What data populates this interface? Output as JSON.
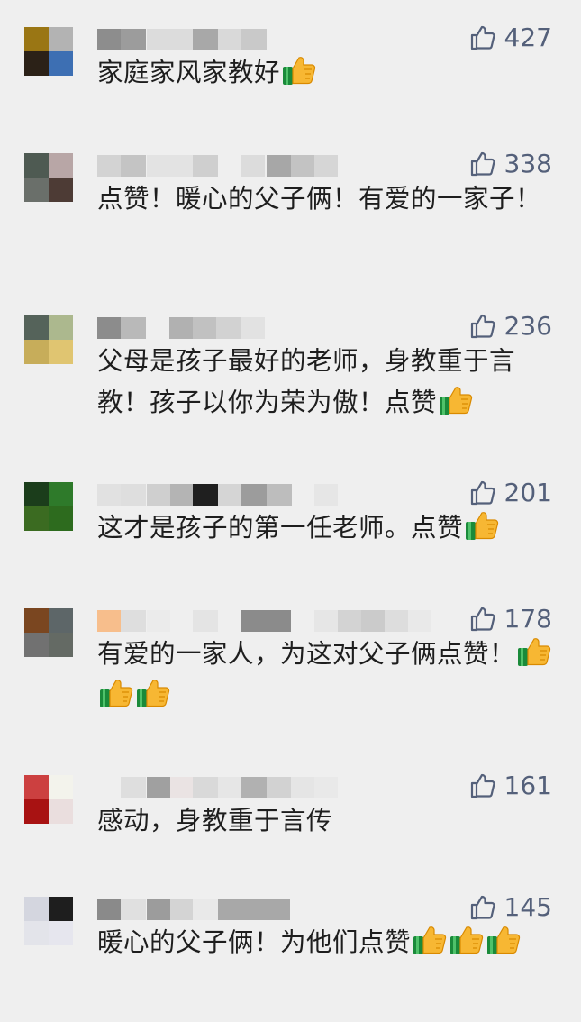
{
  "comments": [
    {
      "text": "家庭家风家教好",
      "likes": "427",
      "thumbs": 1,
      "avatar": [
        "#9a7614",
        "#b3b3b3",
        "#2b2117",
        "#3d6fb3"
      ],
      "name": [
        [
          "#8d8d8d",
          108,
          26
        ],
        [
          "#9c9c9c",
          134,
          28
        ],
        [
          "#dcdcdc",
          163,
          52
        ],
        [
          "#a8a8a8",
          214,
          28
        ],
        [
          "#d9d9d9",
          242,
          26
        ],
        [
          "#c9c9c9",
          268,
          28
        ]
      ]
    },
    {
      "text": "点赞！暖心的父子俩！有爱的一家子！",
      "likes": "338",
      "thumbs": 0,
      "avatar": [
        "#4e5a52",
        "#b8a6a6",
        "#6a6f6a",
        "#4d3b35"
      ],
      "name": [
        [
          "#d3d3d3",
          108,
          26
        ],
        [
          "#c4c4c4",
          134,
          28
        ],
        [
          "#e3e3e3",
          163,
          52
        ],
        [
          "#cfcfcf",
          214,
          28
        ],
        [
          "#dcdcdc",
          268,
          26
        ],
        [
          "#a7a7a7",
          296,
          28
        ],
        [
          "#c3c3c3",
          323,
          26
        ],
        [
          "#d6d6d6",
          349,
          26
        ]
      ]
    },
    {
      "text": "父母是孩子最好的老师，身教重于言教！孩子以你为荣为傲！点赞",
      "likes": "236",
      "thumbs": 1,
      "avatar": [
        "#55635a",
        "#acb88e",
        "#c7ad5a",
        "#e0c571"
      ],
      "name": [
        [
          "#8c8c8c",
          108,
          26
        ],
        [
          "#b9b9b9",
          134,
          28
        ],
        [
          "#b1b1b1",
          188,
          26
        ],
        [
          "#c1c1c1",
          214,
          26
        ],
        [
          "#d2d2d2",
          240,
          28
        ],
        [
          "#e2e2e2",
          268,
          26
        ]
      ]
    },
    {
      "text": "这才是孩子的第一任老师。点赞",
      "likes": "201",
      "thumbs": 1,
      "avatar": [
        "#1b3d1b",
        "#2e7a2a",
        "#3b6b21",
        "#2d6b1e"
      ],
      "name": [
        [
          "#e1e1e1",
          108,
          26
        ],
        [
          "#dedede",
          134,
          28
        ],
        [
          "#cfcfcf",
          163,
          26
        ],
        [
          "#b4b4b4",
          189,
          26
        ],
        [
          "#1f1f1f",
          214,
          52
        ],
        [
          "#d5d5d5",
          242,
          26
        ],
        [
          "#9c9c9c",
          268,
          28
        ],
        [
          "#bdbdbd",
          296,
          28
        ],
        [
          "#e6e6e6",
          349,
          26
        ]
      ]
    },
    {
      "text": "有爱的一家人，为这对父子俩点赞！",
      "likes": "178",
      "thumbs": 3,
      "avatar": [
        "#7a4620",
        "#5d6668",
        "#717171",
        "#646a64"
      ],
      "name": [
        [
          "#f7be8c",
          108,
          26
        ],
        [
          "#dedede",
          134,
          28
        ],
        [
          "#ebebeb",
          163,
          26
        ],
        [
          "#e4e4e4",
          214,
          28
        ],
        [
          "#8b8b8b",
          268,
          55
        ],
        [
          "#e6e6e6",
          349,
          26
        ],
        [
          "#d3d3d3",
          375,
          26
        ],
        [
          "#cbcbcb",
          401,
          26
        ],
        [
          "#dddddd",
          427,
          26
        ],
        [
          "#e9e9e9",
          453,
          26
        ]
      ]
    },
    {
      "text": "感动，身教重于言传",
      "likes": "161",
      "thumbs": 0,
      "avatar": [
        "#cc4040",
        "#f3f3ec",
        "#a81212",
        "#eadede"
      ],
      "name": [
        [
          "#dedede",
          134,
          28
        ],
        [
          "#a0a0a0",
          163,
          26
        ],
        [
          "#eae3e3",
          189,
          26
        ],
        [
          "#d9d9d9",
          214,
          28
        ],
        [
          "#e6e6e6",
          242,
          26
        ],
        [
          "#b1b1b1",
          268,
          28
        ],
        [
          "#d2d2d2",
          296,
          28
        ],
        [
          "#e5e5e5",
          323,
          26
        ],
        [
          "#e9e9e9",
          349,
          26
        ]
      ]
    },
    {
      "text": "暖心的父子俩！为他们点赞",
      "likes": "145",
      "thumbs": 3,
      "avatar": [
        "#d4d6df",
        "#1e1e1e",
        "#e3e4ea",
        "#e6e6ee"
      ],
      "name": [
        [
          "#8a8a8a",
          108,
          26
        ],
        [
          "#e0e0e0",
          134,
          28
        ],
        [
          "#9c9c9c",
          163,
          26
        ],
        [
          "#d4d4d4",
          189,
          26
        ],
        [
          "#e9e9e9",
          214,
          28
        ],
        [
          "#a8a8a8",
          242,
          80
        ]
      ]
    }
  ],
  "colors": {
    "background": "#efefef",
    "like_count": "#54607a",
    "text": "#1e1e1e"
  }
}
